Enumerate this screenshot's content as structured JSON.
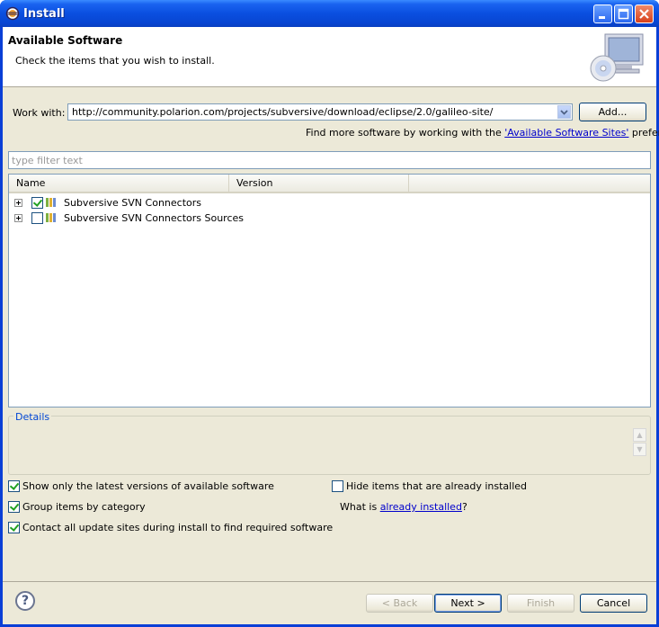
{
  "window": {
    "title": "Install"
  },
  "banner": {
    "title": "Available Software",
    "description": "Check the items that you wish to install."
  },
  "work_with": {
    "label": "Work with:",
    "value": "http://community.polarion.com/projects/subversive/download/eclipse/2.0/galileo-site/",
    "add_button": "Add...",
    "hint_prefix": "Find more software by working with the ",
    "hint_link": "'Available Software Sites'",
    "hint_suffix": " preferences."
  },
  "filter": {
    "placeholder": "type filter text"
  },
  "tree": {
    "columns": [
      "Name",
      "Version"
    ],
    "rows": [
      {
        "label": "Subversive SVN Connectors",
        "version": "",
        "checked": true
      },
      {
        "label": "Subversive SVN Connectors Sources",
        "version": "",
        "checked": false
      }
    ]
  },
  "details": {
    "label": "Details"
  },
  "options": {
    "show_latest": {
      "label": "Show only the latest versions of available software",
      "checked": true
    },
    "group_by_category": {
      "label": "Group items by category",
      "checked": true
    },
    "contact_all_sites": {
      "label": "Contact all update sites during install to find required software",
      "checked": true
    },
    "hide_installed": {
      "label": "Hide items that are already installed",
      "checked": false
    },
    "what_is_prefix": "What is ",
    "what_is_link": "already installed",
    "what_is_suffix": "?"
  },
  "buttons": {
    "back": "< Back",
    "next": "Next >",
    "finish": "Finish",
    "cancel": "Cancel"
  },
  "colors": {
    "title_bar": "#0a4fe0",
    "dialog_bg": "#ece9d8",
    "link": "#0000cc"
  },
  "icons": [
    "eclipse-icon",
    "minimize-icon",
    "maximize-icon",
    "close-icon",
    "computer-cd-icon",
    "dropdown-arrow-icon",
    "expand-icon",
    "package-icon",
    "help-icon"
  ]
}
